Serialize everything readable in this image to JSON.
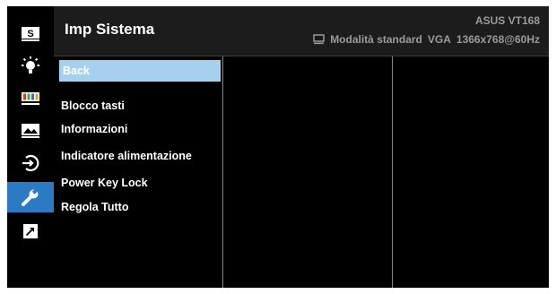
{
  "header": {
    "title": "Imp Sistema",
    "model": "ASUS VT168",
    "mode": "Modalità standard",
    "input": "VGA",
    "resolution": "1366x768@60Hz"
  },
  "sidebar": {
    "items": [
      {
        "icon": "splendid-icon",
        "glyph": "S",
        "active": false
      },
      {
        "icon": "brightness-icon",
        "active": false
      },
      {
        "icon": "color-icon",
        "active": false
      },
      {
        "icon": "image-icon",
        "active": false
      },
      {
        "icon": "input-select-icon",
        "active": false
      },
      {
        "icon": "wrench-icon",
        "active": true
      },
      {
        "icon": "shortcut-arrow-icon",
        "active": false
      }
    ]
  },
  "menu": {
    "items": [
      {
        "label": "Back",
        "selected": true
      },
      {
        "label": "Blocco tasti",
        "selected": false
      },
      {
        "label": "Informazioni",
        "selected": false
      },
      {
        "label": "Indicatore alimentazione",
        "selected": false
      },
      {
        "label": "Power Key Lock",
        "selected": false
      },
      {
        "label": "Regola Tutto",
        "selected": false
      }
    ]
  },
  "colors": {
    "accent": "#2b7bc4",
    "selection": "#a6d1ee",
    "background": "#000000",
    "muted_text": "#9a9a9a"
  }
}
